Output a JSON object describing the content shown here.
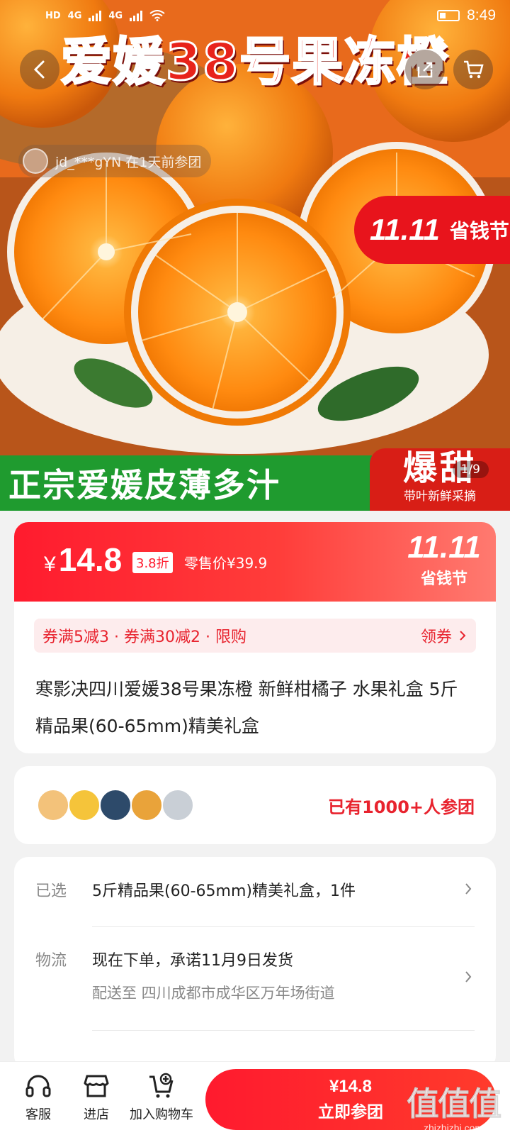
{
  "status_bar": {
    "network_left": "HD",
    "signal1": "4G",
    "signal2": "4G",
    "time": "8:49"
  },
  "hero": {
    "title": "爱媛38号果冻橙",
    "recent_join": "jd_***gYN 在1天前参团",
    "promo_logo": "11.11",
    "promo_text": "省钱节",
    "banner_left": "正宗爱媛皮薄多汁",
    "banner_right_big": "爆甜",
    "banner_right_small": "带叶新鲜采摘",
    "image_counter": "1/9"
  },
  "price": {
    "currency": "¥",
    "amount": "14.8",
    "discount": "3.8折",
    "retail": "零售价¥39.9",
    "promo_logo": "11.11",
    "promo_text": "省钱节"
  },
  "coupon": {
    "text": "券满5减3 · 券满30减2 · 限购",
    "action": "领券"
  },
  "product": {
    "title": "寒影决四川爱媛38号果冻橙 新鲜柑橘子 水果礼盒 5斤精品果(60-65mm)精美礼盒"
  },
  "group": {
    "count_text": "已有1000+人参团",
    "avatar_colors": [
      "#f3c27a",
      "#f5c43a",
      "#2d4a6a",
      "#e9a33a",
      "#c9cfd6"
    ]
  },
  "info": {
    "selected_label": "已选",
    "selected_value": "5斤精品果(60-65mm)精美礼盒，1件",
    "logistics_label": "物流",
    "logistics_value": "现在下单，承诺11月9日发货",
    "delivery_text": "配送至  四川成都市成华区万年场街道"
  },
  "bottom_bar": {
    "service": "客服",
    "store": "进店",
    "add_cart": "加入购物车",
    "buy_price": "¥14.8",
    "buy_label": "立即参团"
  },
  "watermark": {
    "big": "值值值",
    "small": "zhizhizhi.com"
  },
  "colors": {
    "accent": "#ff1b2e",
    "coupon_bg": "#fdeced",
    "green_banner": "#1f9b2f"
  }
}
